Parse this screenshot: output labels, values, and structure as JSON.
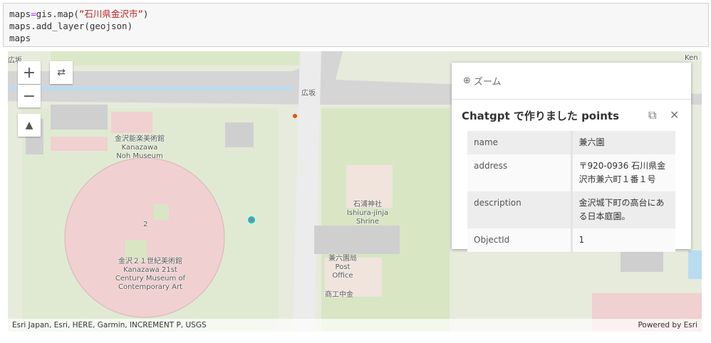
{
  "code": {
    "line1_pre": "maps",
    "line1_op": "=",
    "line1_mid": "gis.map(",
    "line1_str": "”石川県金沢市”",
    "line1_post": ")",
    "line2": "maps.add_layer(geojson)",
    "line3": "maps"
  },
  "map": {
    "labels": {
      "hirosaka_tl": "広坂",
      "hirosaka": "広坂",
      "noh_ja": "金沢能楽美術館",
      "noh_en1": "Kanazawa",
      "noh_en2": "Noh Museum",
      "num2": "2",
      "museum_ja": "金沢２１世紀美術館",
      "museum_en1": "Kanazawa 21st",
      "museum_en2": "Century Museum of",
      "museum_en3": "Contemporary Art",
      "shrine_ja": "石浦神社",
      "shrine_en1": "Ishiura-jinja",
      "shrine_en2": "Shrine",
      "post_ja": "兼六園局",
      "post_en1": "Post",
      "post_en2": "Office",
      "bank": "商工中金",
      "ken": "Ken"
    },
    "controls": {
      "zoom_in": "+",
      "zoom_out": "−"
    },
    "attribution": "Esri Japan, Esri, HERE, Garmin, INCREMENT P, USGS",
    "powered_by": "Powered by Esri"
  },
  "popup": {
    "zoom_label": "ズーム",
    "title": "Chatgpt で作りました points",
    "rows": [
      {
        "field": "name",
        "value": "兼六園"
      },
      {
        "field": "address",
        "value": "〒920-0936 石川県金沢市兼六町１番１号"
      },
      {
        "field": "description",
        "value": "金沢城下町の高台にある日本庭園。"
      },
      {
        "field": "ObjectId",
        "value": "1"
      }
    ]
  },
  "colors": {
    "water": "#b9dcf0",
    "park": "#d8e6c4",
    "building": "#cfcfcf",
    "museum": "#f0d0d0",
    "point": "#00b0c8"
  }
}
